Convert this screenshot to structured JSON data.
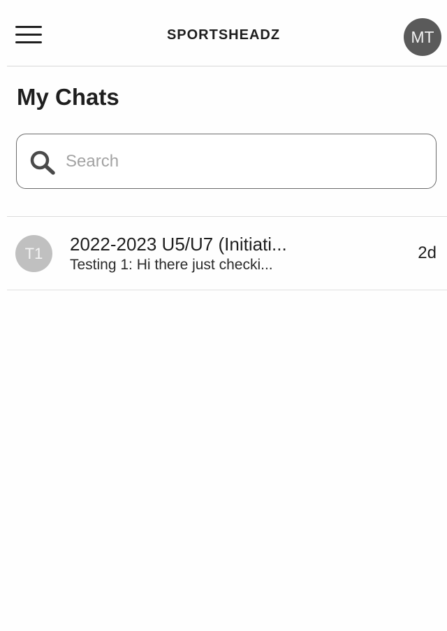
{
  "header": {
    "menu_icon": "hamburger-menu-icon",
    "brand": "SPORTSHEADZ",
    "user_initials": "MT"
  },
  "page": {
    "title": "My Chats"
  },
  "search": {
    "icon": "search-icon",
    "placeholder": "Search",
    "value": ""
  },
  "chats": [
    {
      "initials": "T1",
      "title": "2022-2023 U5/U7 (Initiati...",
      "preview": "Testing 1: Hi there just checki...",
      "time": "2d"
    }
  ],
  "colors": {
    "user_avatar_bg": "#5a5a5a",
    "chat_avatar_bg": "#c0c0c0",
    "divider": "#d8d8d8",
    "text": "#1e1e1e"
  }
}
